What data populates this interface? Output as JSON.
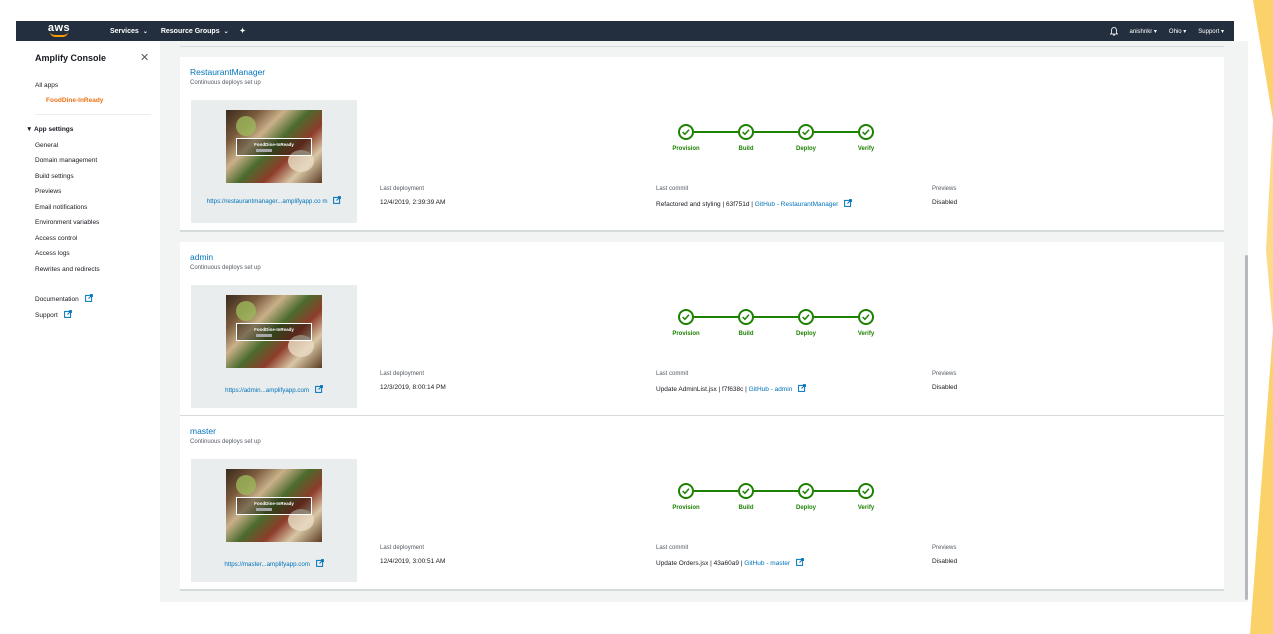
{
  "topnav": {
    "logo": "aws",
    "services": "Services",
    "resource_groups": "Resource Groups",
    "user": "anishnkr",
    "region": "Ohio",
    "support": "Support"
  },
  "sidebar": {
    "title": "Amplify Console",
    "all_apps": "All apps",
    "active_app": "FoodDine-InReady",
    "app_settings": "App settings",
    "items": [
      "General",
      "Domain management",
      "Build settings",
      "Previews",
      "Email notifications",
      "Environment variables",
      "Access control",
      "Access logs",
      "Rewrites and redirects"
    ],
    "documentation": "Documentation",
    "support": "Support"
  },
  "labels": {
    "status": "Continuous deploys set up",
    "last_deployment": "Last deployment",
    "last_commit": "Last commit",
    "previews": "Previews",
    "thumb_title": "FoodDine-InReady",
    "stages": [
      "Provision",
      "Build",
      "Deploy",
      "Verify"
    ]
  },
  "branches": [
    {
      "name": "RestaurantManager",
      "url": "https://restaurantmanager...amplifyapp.co m",
      "last_deployment": "12/4/2019, 2:39:39 AM",
      "commit_text": "Refactored and styling | 63f751d |",
      "commit_link": "GitHub - RestaurantManager",
      "previews": "Disabled"
    },
    {
      "name": "admin",
      "url": "https://admin...amplifyapp.com",
      "last_deployment": "12/3/2019, 8:00:14 PM",
      "commit_text": "Update AdminList.jsx | f7f638c |",
      "commit_link": "GitHub - admin",
      "previews": "Disabled"
    },
    {
      "name": "master",
      "url": "https://master...amplifyapp.com",
      "last_deployment": "12/4/2019, 3:00:51 AM",
      "commit_text": "Update Orders.jsx | 43a60a9 |",
      "commit_link": "GitHub - master",
      "previews": "Disabled"
    }
  ],
  "colors": {
    "nav_bg": "#232f3e",
    "accent_orange": "#ec7211",
    "link_blue": "#0073bb",
    "success_green": "#1d8102",
    "decor_yellow": "#fbd26a"
  }
}
